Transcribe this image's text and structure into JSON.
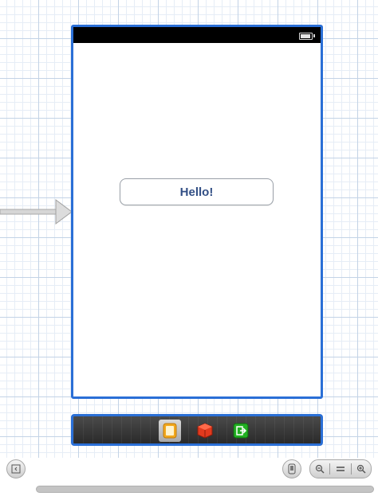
{
  "scene": {
    "button_label": "Hello!"
  },
  "dock": {
    "icons": [
      "view-controller-icon",
      "first-responder-icon",
      "exit-icon"
    ]
  },
  "colors": {
    "selection_blue": "#2a6fd6",
    "button_text": "#324f85",
    "status_bar": "#000000",
    "grid_line": "#c3d3e6"
  }
}
